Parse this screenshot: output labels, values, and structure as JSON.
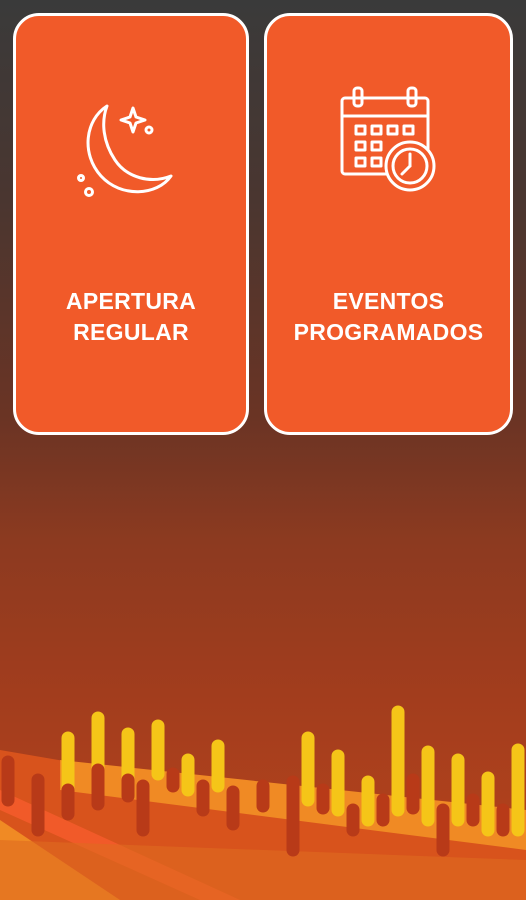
{
  "menu": {
    "cards": [
      {
        "line1": "APERTURA",
        "line2": "REGULAR",
        "icon": "moon-stars-icon"
      },
      {
        "line1": "EVENTOS",
        "line2": "PROGRAMADOS",
        "icon": "calendar-clock-icon"
      }
    ]
  },
  "colors": {
    "card_bg": "#f15a29",
    "card_border": "#ffffff",
    "accent_yellow": "#f5c518",
    "accent_orange": "#f08a24"
  }
}
